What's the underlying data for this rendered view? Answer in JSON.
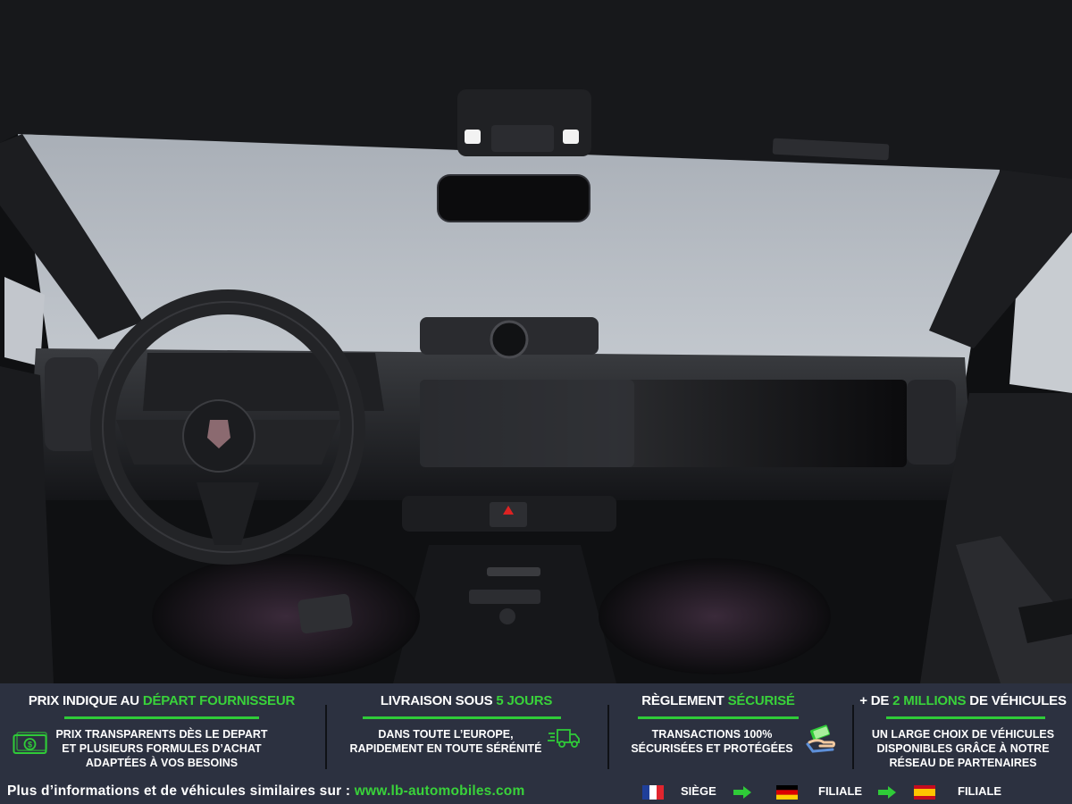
{
  "banner": {
    "columns": [
      {
        "title_pre": "PRIX INDIQUE AU ",
        "title_hl": "DÉPART FOURNISSEUR",
        "title_post": "",
        "lines": [
          "PRIX TRANSPARENTS DÈS LE DEPART",
          "ET PLUSIEURS FORMULES D’ACHAT",
          "ADAPTÉES À VOS BESOINS"
        ],
        "icon": "cash-icon"
      },
      {
        "title_pre": "LIVRAISON SOUS ",
        "title_hl": "5 JOURS",
        "title_post": "",
        "lines": [
          "DANS TOUTE L’EUROPE,",
          "RAPIDEMENT EN TOUTE SÉRÉNITÉ"
        ],
        "icon": "delivery-truck-icon"
      },
      {
        "title_pre": "RÈGLEMENT ",
        "title_hl": "SÉCURISÉ",
        "title_post": "",
        "lines": [
          "TRANSACTIONS 100%",
          "SÉCURISÉES ET PROTÉGÉES"
        ],
        "icon": "payment-hand-icon"
      },
      {
        "title_pre": "+ DE ",
        "title_hl": "2 MILLIONS",
        "title_post": " DE VÉHICULES",
        "lines": [
          "UN LARGE CHOIX DE VÉHICULES",
          "DISPONIBLES GRÂCE À NOTRE",
          "RÉSEAU DE PARTENAIRES"
        ]
      }
    ]
  },
  "footer": {
    "text": "Plus d’informations et de véhicules similaires sur : ",
    "link": "www.lb-automobiles.com",
    "locations": [
      {
        "label": "SIÈGE",
        "flag": "france-flag-icon"
      },
      {
        "label": "FILIALE",
        "flag": "germany-flag-icon"
      },
      {
        "label": "FILIALE",
        "flag": "spain-flag-icon"
      }
    ]
  },
  "colors": {
    "accent": "#39d23a",
    "banner_bg": "#2c3140",
    "text": "#ffffff"
  }
}
